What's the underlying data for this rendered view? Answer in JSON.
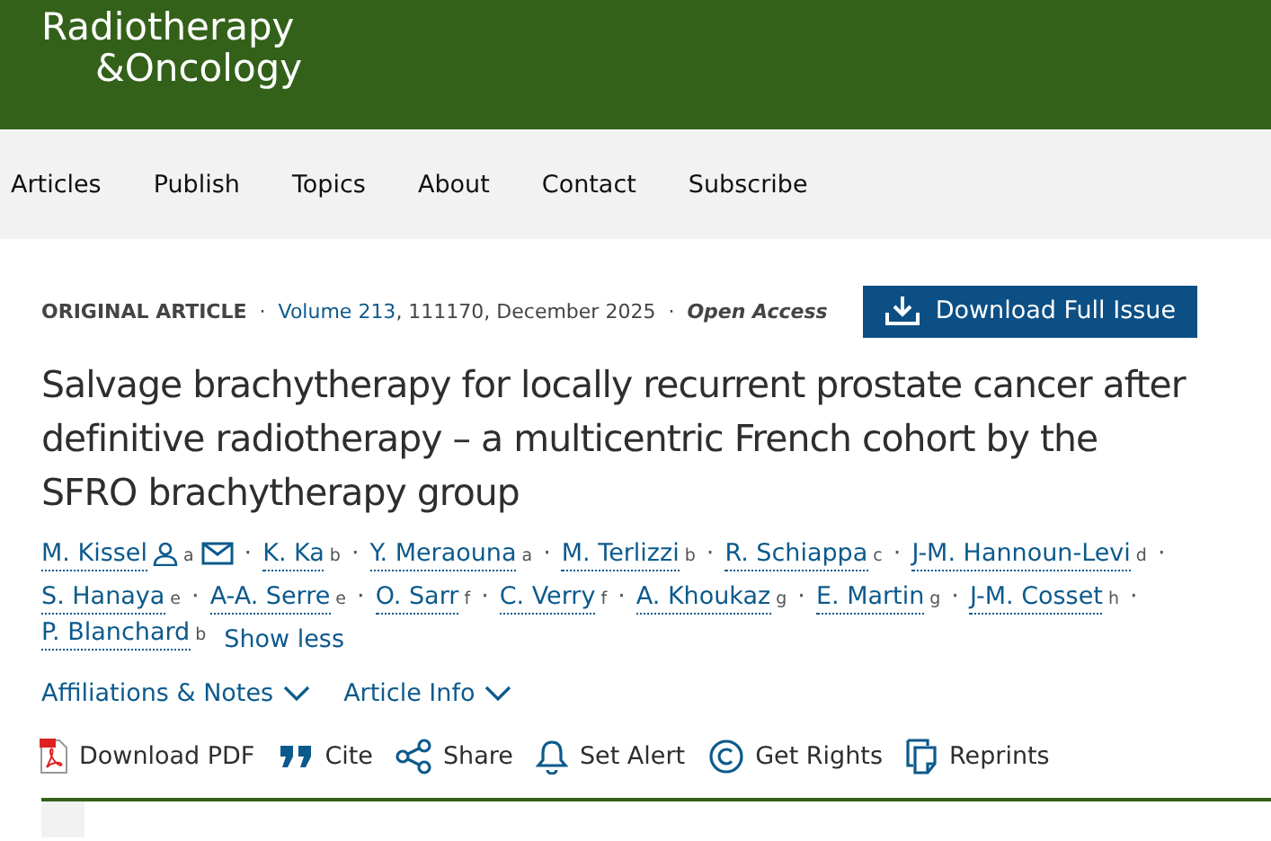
{
  "header": {
    "logo_lines": [
      "Radiotherapy",
      "&Oncology"
    ]
  },
  "nav": [
    {
      "label": "Articles"
    },
    {
      "label": "Publish"
    },
    {
      "label": "Topics"
    },
    {
      "label": "About"
    },
    {
      "label": "Contact"
    },
    {
      "label": "Subscribe"
    }
  ],
  "meta": {
    "type": "ORIGINAL ARTICLE",
    "separator_1": "·",
    "volume": "Volume 213",
    "details": ", 111170, December 2025",
    "separator_2": "·",
    "access": "Open Access"
  },
  "download_issue_button": "Download Full Issue",
  "title": "Salvage brachytherapy for locally recurrent prostate cancer after definitive radiotherapy – a multicentric French cohort by the SFRO brachytherapy group",
  "authors": [
    {
      "kind": "corresponding",
      "name": "M. Kissel",
      "sup": "a",
      "separator": "·"
    },
    {
      "kind": "plain",
      "name": "K. Ka",
      "sup": "b",
      "separator": "·"
    },
    {
      "kind": "plain",
      "name": "Y. Meraouna",
      "sup": "a",
      "separator": "·"
    },
    {
      "kind": "plain",
      "name": "M. Terlizzi",
      "sup": "b",
      "separator": "·"
    },
    {
      "kind": "plain",
      "name": "R. Schiappa",
      "sup": "c",
      "separator": "·"
    },
    {
      "kind": "plain",
      "name": "J-M. Hannoun-Levi",
      "sup": "d",
      "separator": "·"
    },
    {
      "kind": "plain",
      "name": "S. Hanaya",
      "sup": "e",
      "separator": "·"
    },
    {
      "kind": "plain",
      "name": "A-A. Serre",
      "sup": "e",
      "separator": "·"
    },
    {
      "kind": "plain",
      "name": "O. Sarr",
      "sup": "f",
      "separator": "·"
    },
    {
      "kind": "plain",
      "name": "C. Verry",
      "sup": "f",
      "separator": "·"
    },
    {
      "kind": "plain",
      "name": "A. Khoukaz",
      "sup": "g",
      "separator": "·"
    },
    {
      "kind": "plain",
      "name": "E. Martin",
      "sup": "g",
      "separator": "·"
    },
    {
      "kind": "plain",
      "name": "J-M. Cosset",
      "sup": "h",
      "separator": "·"
    },
    {
      "kind": "plain",
      "name": "P. Blanchard",
      "sup": "b"
    }
  ],
  "show_less": "Show less",
  "toggles": [
    {
      "label": "Affiliations & Notes",
      "expanded": false
    },
    {
      "label": "Article Info",
      "expanded": false
    }
  ],
  "actions": [
    {
      "kind": "pdf",
      "label": "Download PDF"
    },
    {
      "kind": "cite",
      "label": "Cite"
    },
    {
      "kind": "share",
      "label": "Share"
    },
    {
      "kind": "alert",
      "label": "Set Alert"
    },
    {
      "kind": "rights",
      "label": "Get Rights"
    },
    {
      "kind": "reprints",
      "label": "Reprints"
    }
  ]
}
